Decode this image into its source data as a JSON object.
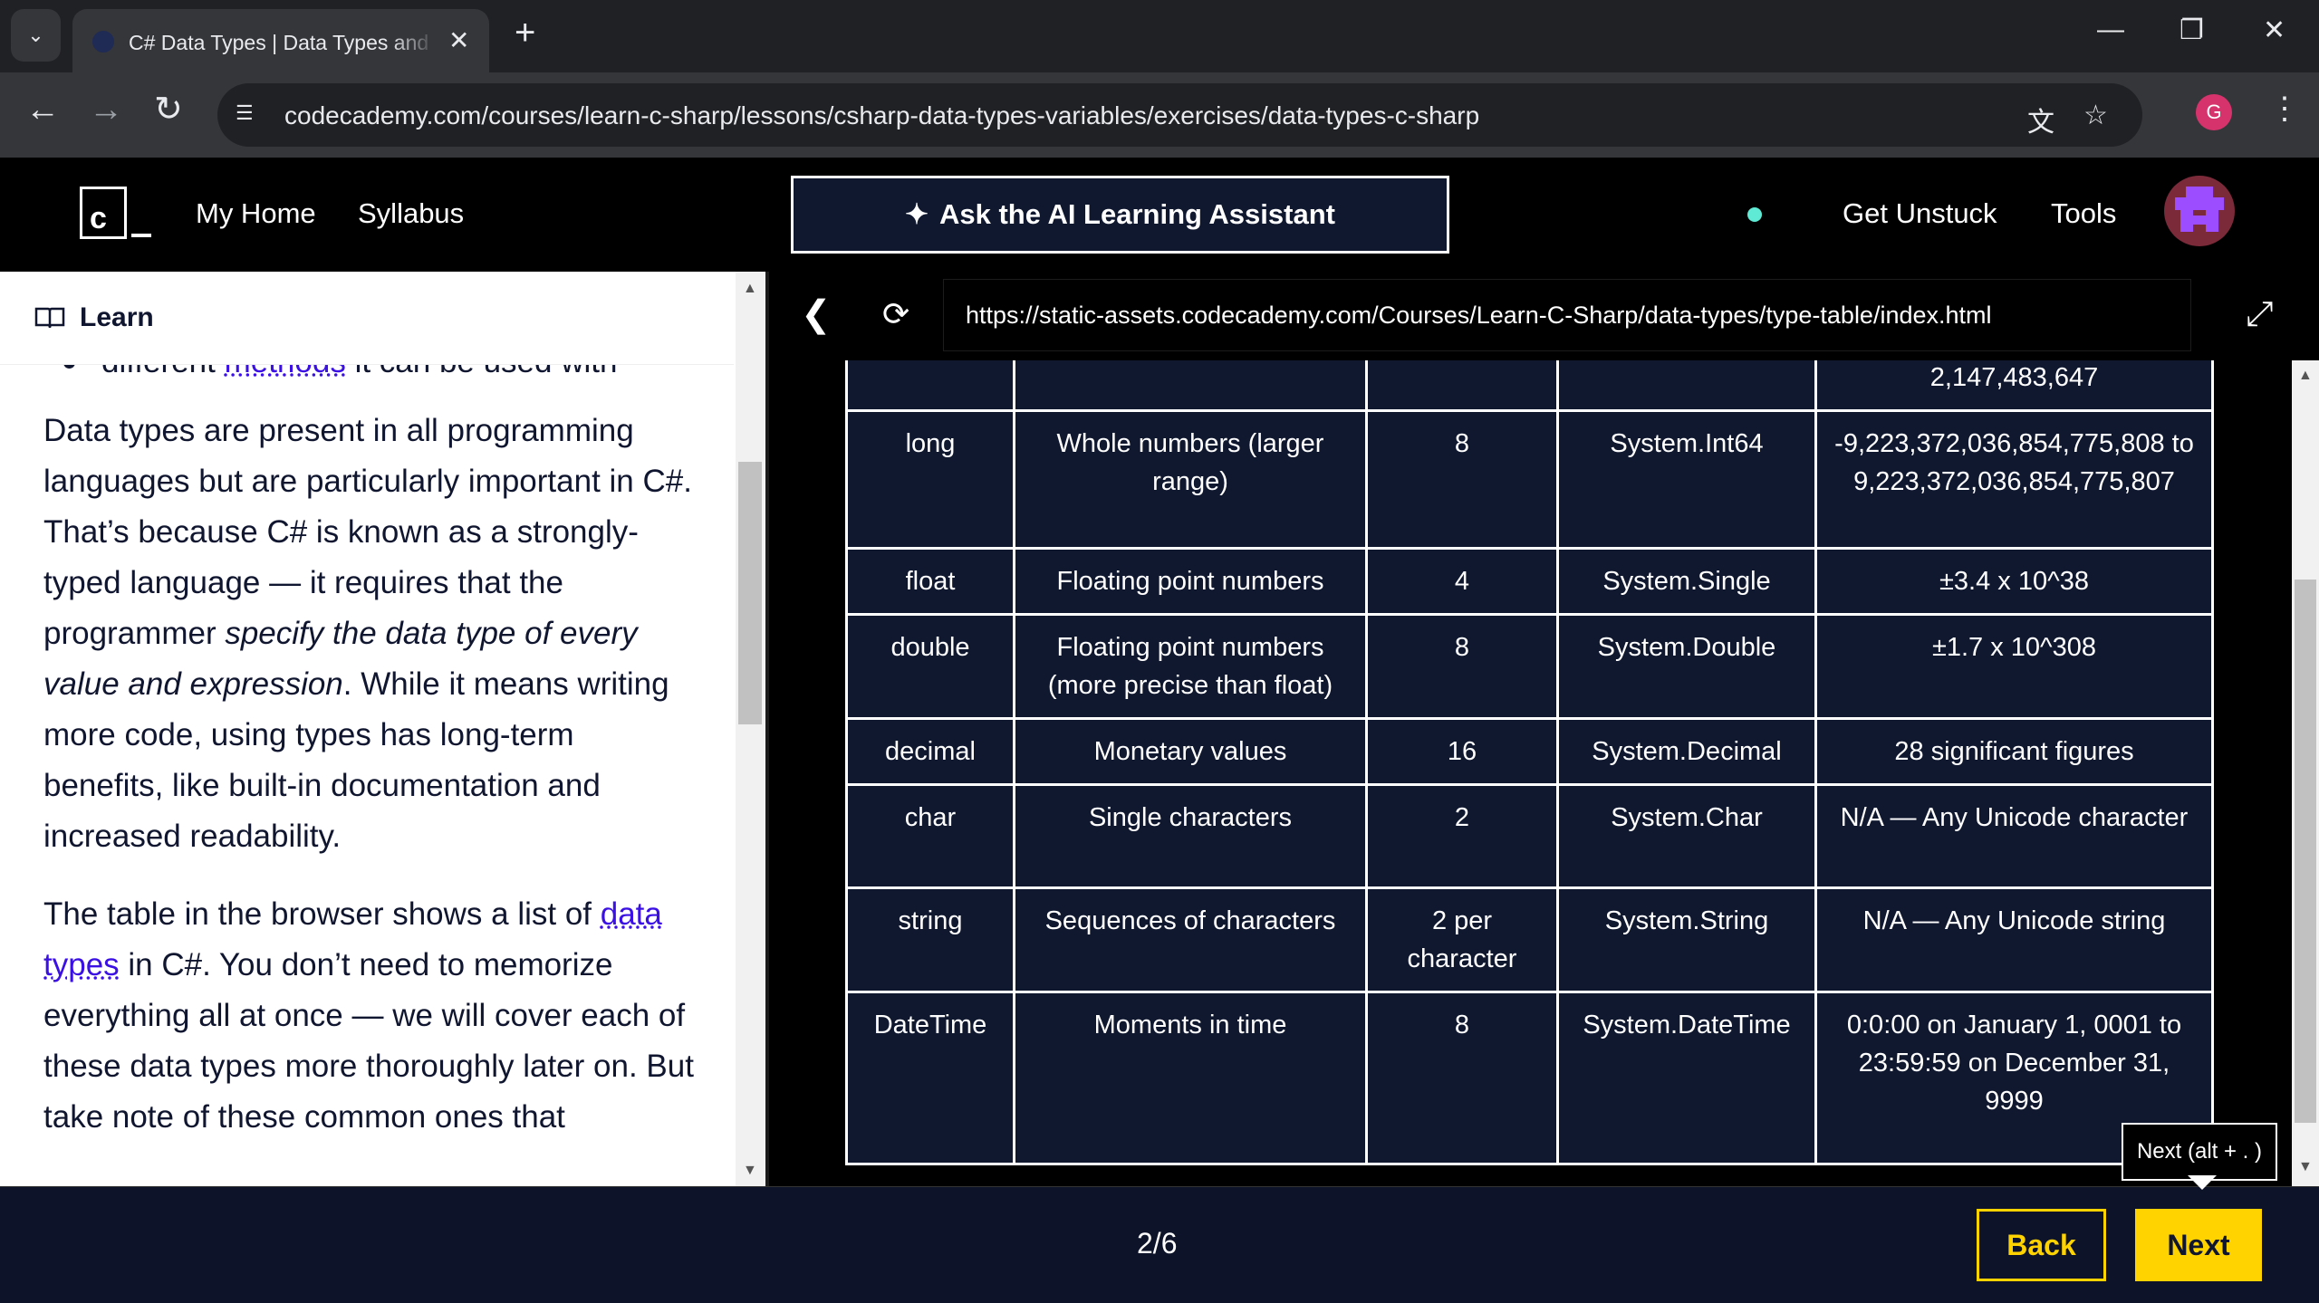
{
  "browser": {
    "tab_title": "C# Data Types | Data Types and",
    "url": "codecademy.com/courses/learn-c-sharp/lessons/csharp-data-types-variables/exercises/data-types-c-sharp",
    "profile_initial": "G"
  },
  "header": {
    "nav": [
      "My Home",
      "Syllabus"
    ],
    "ai_button": "Ask the AI Learning Assistant",
    "get_unstuck": "Get Unstuck",
    "tools": "Tools"
  },
  "learn": {
    "title": "Learn",
    "bullet_prefix": "different",
    "bullet_link": "methods",
    "bullet_suffix": "it can be used with",
    "p1_a": "Data types are present in all programming languages but are particularly important in C#. That’s because C# is known as a strongly-typed language — it requires that the programmer",
    "p1_em": "specify the data type of every value and expression",
    "p1_b": ". While it means writing more code, using types has long-term benefits, like built-in documentation and increased readability.",
    "p2_a": "The table in the browser shows a list of",
    "p2_link": "data types",
    "p2_b": "in C#. You don’t need to memorize everything all at once — we will cover each of these data types more thoroughly later on. But take note of these common ones that"
  },
  "browser_panel": {
    "url": "https://static-assets.codecademy.com/Courses/Learn-C-Sharp/data-types/type-table/index.html"
  },
  "table": {
    "rows": [
      {
        "type": "",
        "description": "",
        "bytes": "",
        "dotnet": "",
        "range": "2,147,483,647"
      },
      {
        "type": "long",
        "description": "Whole numbers (larger range)",
        "bytes": "8",
        "dotnet": "System.Int64",
        "range": "-9,223,372,036,854,775,808 to 9,223,372,036,854,775,807"
      },
      {
        "type": "float",
        "description": "Floating point numbers",
        "bytes": "4",
        "dotnet": "System.Single",
        "range": "±3.4 x 10^38"
      },
      {
        "type": "double",
        "description": "Floating point numbers (more precise than float)",
        "bytes": "8",
        "dotnet": "System.Double",
        "range": "±1.7 x 10^308"
      },
      {
        "type": "decimal",
        "description": "Monetary values",
        "bytes": "16",
        "dotnet": "System.Decimal",
        "range": "28 significant figures"
      },
      {
        "type": "char",
        "description": "Single characters",
        "bytes": "2",
        "dotnet": "System.Char",
        "range": "N/A — Any Unicode character"
      },
      {
        "type": "string",
        "description": "Sequences of characters",
        "bytes": "2 per character",
        "dotnet": "System.String",
        "range": "N/A — Any Unicode string"
      },
      {
        "type": "DateTime",
        "description": "Moments in time",
        "bytes": "8",
        "dotnet": "System.DateTime",
        "range": "0:0:00 on January 1, 0001 to 23:59:59 on December 31, 9999"
      }
    ]
  },
  "footer": {
    "progress": "2/6",
    "back": "Back",
    "next": "Next",
    "tooltip": "Next (alt + . )"
  },
  "colors": {
    "accent_yellow": "#ffd300",
    "table_bg": "#101830",
    "link": "#3a10e5"
  }
}
